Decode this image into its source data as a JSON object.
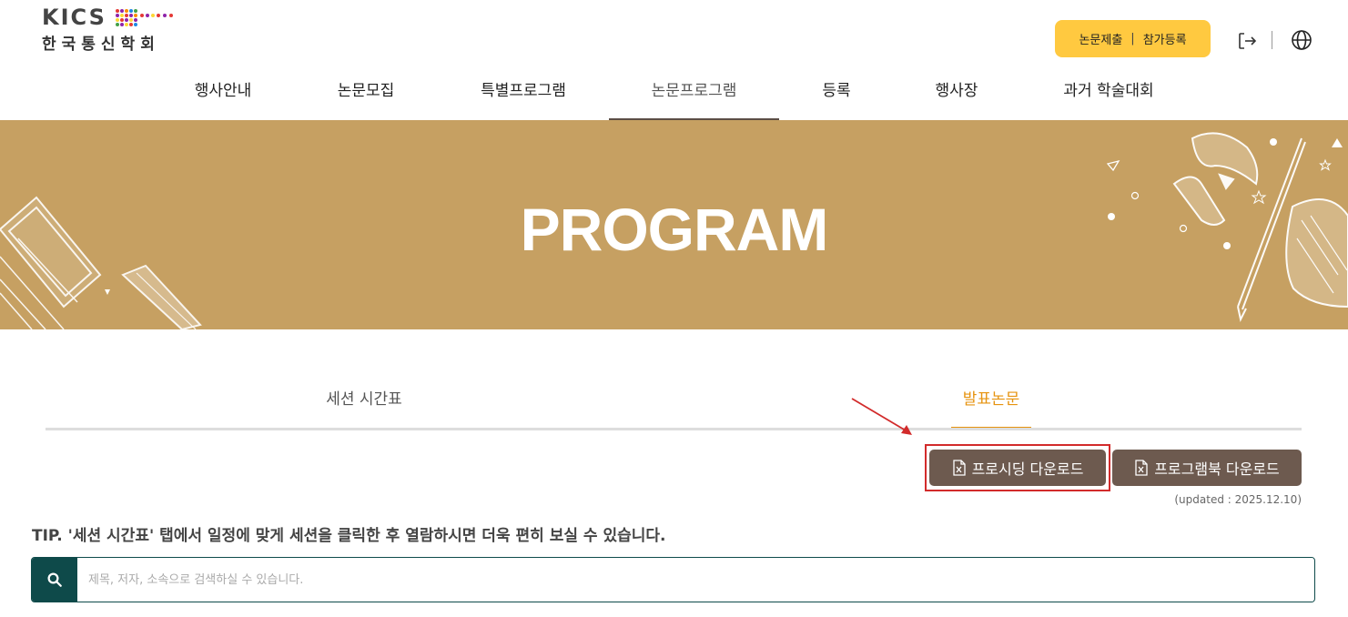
{
  "header": {
    "logo_text": "KICS",
    "logo_korean": "한국통신학회",
    "submit_label": "논문제출",
    "register_label": "참가등록",
    "separator": "|",
    "logout_icon": "logout-icon",
    "globe_icon": "globe-icon"
  },
  "nav": {
    "items": [
      {
        "label": "행사안내"
      },
      {
        "label": "논문모집"
      },
      {
        "label": "특별프로그램"
      },
      {
        "label": "논문프로그램"
      },
      {
        "label": "등록"
      },
      {
        "label": "행사장"
      },
      {
        "label": "과거 학술대회"
      }
    ],
    "active_index": 3
  },
  "banner": {
    "title": "PROGRAM",
    "background": "#c6a062"
  },
  "tabs": [
    {
      "label": "세션 시간표",
      "active": false
    },
    {
      "label": "발표논문",
      "active": true
    }
  ],
  "downloads": {
    "proceedings_label": "프로시딩 다운로드",
    "programbook_label": "프로그램북 다운로드",
    "updated_text": "(updated : 2025.12.10)",
    "icon": "excel-file-icon"
  },
  "tip": "TIP. '세션 시간표' 탭에서 일정에 맞게 세션을 클릭한 후 열람하시면 더욱 편히 보실 수 있습니다.",
  "search": {
    "placeholder": "제목, 저자, 소속으로 검색하실 수 있습니다.",
    "value": "",
    "icon": "search-icon"
  },
  "colors": {
    "accent": "#e6930f",
    "button_brown": "#6d5a4f",
    "search_teal": "#0e4a4a",
    "submit_yellow": "#ffc940",
    "highlight_red": "#d22b2b"
  }
}
